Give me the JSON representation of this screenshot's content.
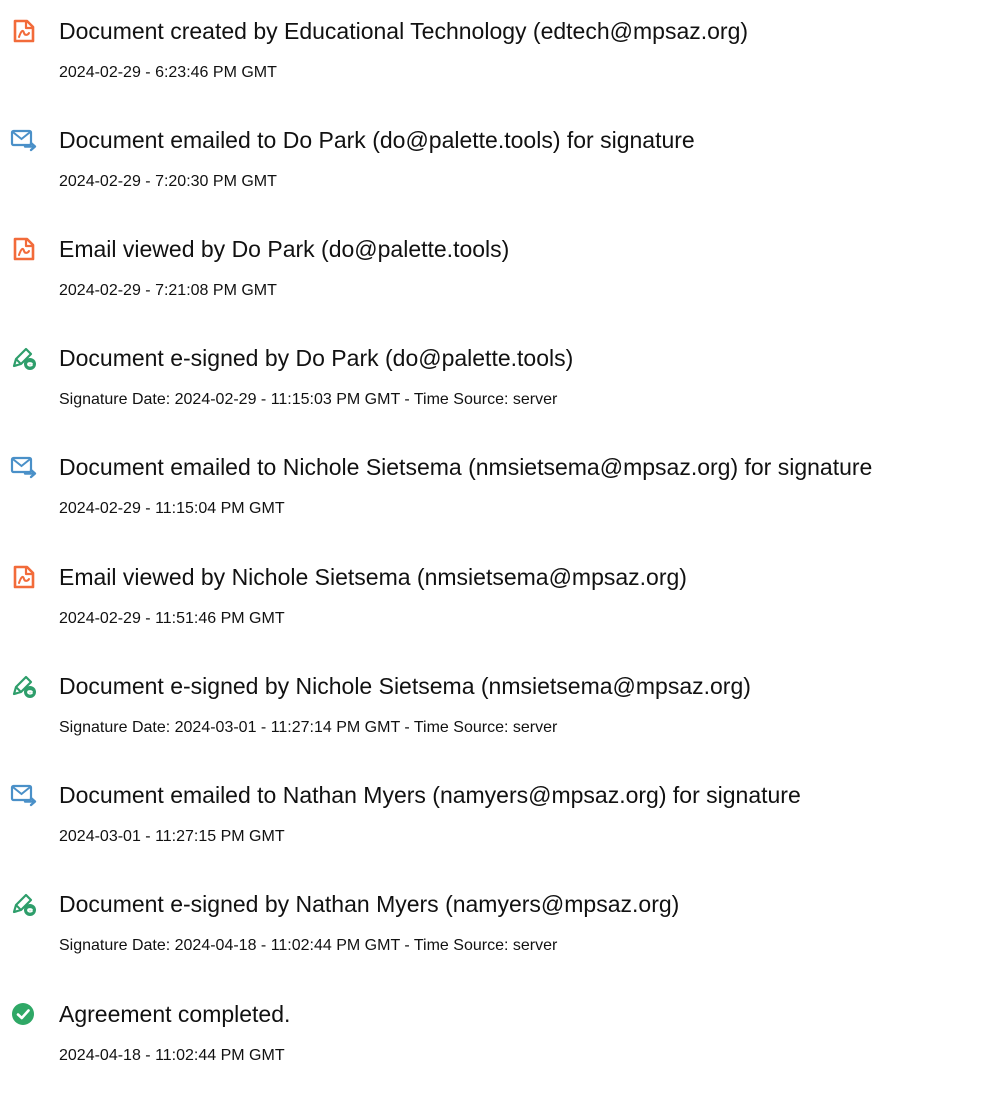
{
  "colors": {
    "created_icon": "#F26B3A",
    "emailed_icon": "#4A90C8",
    "signed_icon": "#2E9E6B",
    "completed_icon": "#2FA866"
  },
  "events": [
    {
      "icon": "document-created-icon",
      "title": "Document created by Educational Technology (edtech@mpsaz.org)",
      "detail": "2024-02-29 - 6:23:46 PM GMT"
    },
    {
      "icon": "email-sent-icon",
      "title": "Document emailed to Do Park (do@palette.tools) for signature",
      "detail": "2024-02-29 - 7:20:30 PM GMT"
    },
    {
      "icon": "document-viewed-icon",
      "title": "Email viewed by Do Park (do@palette.tools)",
      "detail": "2024-02-29 - 7:21:08 PM GMT"
    },
    {
      "icon": "e-sign-pen-icon",
      "title": "Document e-signed by Do Park (do@palette.tools)",
      "detail": "Signature Date: 2024-02-29 - 11:15:03 PM GMT - Time Source: server"
    },
    {
      "icon": "email-sent-icon",
      "title": "Document emailed to Nichole Sietsema (nmsietsema@mpsaz.org) for signature",
      "detail": "2024-02-29 - 11:15:04 PM GMT"
    },
    {
      "icon": "document-viewed-icon",
      "title": "Email viewed by Nichole Sietsema (nmsietsema@mpsaz.org)",
      "detail": "2024-02-29 - 11:51:46 PM GMT"
    },
    {
      "icon": "e-sign-pen-icon",
      "title": "Document e-signed by Nichole Sietsema (nmsietsema@mpsaz.org)",
      "detail": "Signature Date: 2024-03-01 - 11:27:14 PM GMT - Time Source: server"
    },
    {
      "icon": "email-sent-icon",
      "title": "Document emailed to Nathan Myers (namyers@mpsaz.org) for signature",
      "detail": "2024-03-01 - 11:27:15 PM GMT"
    },
    {
      "icon": "e-sign-pen-icon",
      "title": "Document e-signed by Nathan Myers (namyers@mpsaz.org)",
      "detail": "Signature Date: 2024-04-18 - 11:02:44 PM GMT - Time Source: server"
    },
    {
      "icon": "checkmark-circle-icon",
      "title": "Agreement completed.",
      "detail": "2024-04-18 - 11:02:44 PM GMT"
    }
  ]
}
